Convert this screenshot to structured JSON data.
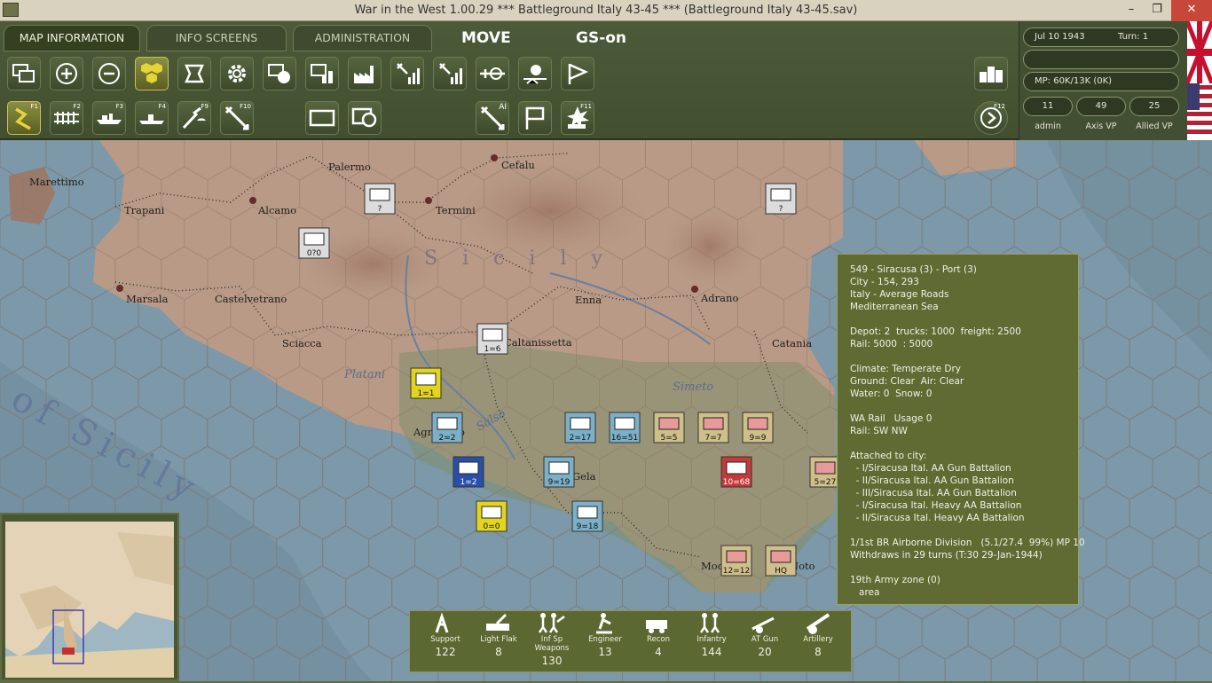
{
  "window": {
    "title": "War in the West 1.00.29          ***   Battleground Italy 43-45   ***   (Battleground Italy 43-45.sav)",
    "minimize": "–",
    "maximize": "❐",
    "close": "✕"
  },
  "tabs": [
    {
      "label": "MAP INFORMATION",
      "active": true
    },
    {
      "label": "INFO SCREENS",
      "active": false
    },
    {
      "label": "ADMINISTRATION",
      "active": false
    }
  ],
  "mode": {
    "phase": "MOVE",
    "gs": "GS-on"
  },
  "toolbar_row1": [
    "windows-icon",
    "zoom-in-icon",
    "zoom-out-icon",
    "hex-grid-icon",
    "frame-icon",
    "gear-icon",
    "unit-display-icon",
    "depot-icon",
    "factory-icon",
    "air-interdict-icon",
    "air-supply-icon",
    "airfield-icon",
    "weather-icon",
    "flag-icon"
  ],
  "toolbar_row2": [
    {
      "icon": "move-path-icon",
      "key": "F1"
    },
    {
      "icon": "rail-icon",
      "key": "F2"
    },
    {
      "icon": "naval-transport-icon",
      "key": "F3"
    },
    {
      "icon": "amphibious-icon",
      "key": "F4"
    },
    {
      "icon": "airdrop-icon",
      "key": "F9"
    },
    {
      "icon": "air-attack-icon",
      "key": "F10"
    },
    {
      "icon": "rectangle-icon",
      "key": ""
    },
    {
      "icon": "zone-icon",
      "key": ""
    },
    {
      "icon": "ai-attack-icon",
      "key": "AI"
    },
    {
      "icon": "hq-flag-icon",
      "key": ""
    },
    {
      "icon": "explosion-icon",
      "key": "F11"
    },
    {
      "icon": "end-turn-icon",
      "key": "F12"
    }
  ],
  "status": {
    "date": "Jul 10 1943",
    "turn": "Turn: 1",
    "mp": "MP:  60K/13K (0K)",
    "admin_value": "11",
    "admin_label": "admin",
    "axis_vp": "49",
    "axis_label": "Axis VP",
    "allied_vp": "25",
    "allied_label": "Allied VP"
  },
  "map_labels": [
    {
      "text": "Marettimo"
    },
    {
      "text": "Trapani"
    },
    {
      "text": "Alcamo"
    },
    {
      "text": "Palermo"
    },
    {
      "text": "Termini"
    },
    {
      "text": "Cefalu"
    },
    {
      "text": "Marsala"
    },
    {
      "text": "Castelvetrano"
    },
    {
      "text": "Sciacca"
    },
    {
      "text": "Caltanissetta"
    },
    {
      "text": "Enna"
    },
    {
      "text": "Adrano"
    },
    {
      "text": "Catania"
    },
    {
      "text": "Agrigento"
    },
    {
      "text": "Gela"
    },
    {
      "text": "Modica"
    },
    {
      "text": "Noto"
    },
    {
      "text": "Sicily"
    },
    {
      "text": "Platani"
    },
    {
      "text": "Salso"
    },
    {
      "text": "Simeto"
    },
    {
      "text": "of Sicily"
    }
  ],
  "counters": [
    {
      "label": "?",
      "side": "axis-unknown"
    },
    {
      "label": "?",
      "side": "axis-unknown"
    },
    {
      "label": "0?0",
      "side": "axis-unknown"
    },
    {
      "label": "1=6",
      "side": "axis"
    },
    {
      "label": "1=1",
      "side": "allied"
    },
    {
      "label": "2=2",
      "side": "allied"
    },
    {
      "label": "1=2",
      "side": "allied"
    },
    {
      "label": "9=19",
      "side": "allied"
    },
    {
      "label": "2=17",
      "side": "allied"
    },
    {
      "label": "16=51",
      "side": "allied"
    },
    {
      "label": "5=5",
      "side": "axis"
    },
    {
      "label": "7=7",
      "side": "axis"
    },
    {
      "label": "9=9",
      "side": "axis"
    },
    {
      "label": "10=68",
      "side": "axis"
    },
    {
      "label": "5=27",
      "side": "axis"
    },
    {
      "label": "0=0",
      "side": "allied"
    },
    {
      "label": "9=18",
      "side": "allied"
    },
    {
      "label": "12=12",
      "side": "axis"
    },
    {
      "label": "HQ",
      "side": "axis"
    }
  ],
  "info_panel": {
    "lines": [
      "549 - Siracusa (3) - Port (3)",
      "City - 154, 293",
      "Italy - Average Roads",
      "Mediterranean Sea",
      "",
      "Depot: 2  trucks: 1000  freight: 2500",
      "Rail: 5000  : 5000",
      "",
      "Climate: Temperate Dry",
      "Ground: Clear  Air: Clear",
      "Water: 0  Snow: 0",
      "",
      "WA Rail   Usage 0",
      "Rail: SW NW",
      "",
      "Attached to city:",
      "  - I/Siracusa Ital. AA Gun Battalion",
      "  - II/Siracusa Ital. AA Gun Battalion",
      "  - III/Siracusa Ital. AA Gun Battalion",
      "  - I/Siracusa Ital. Heavy AA Battalion",
      "  - II/Siracusa Ital. Heavy AA Battalion",
      "",
      "1/1st BR Airborne Division   (5.1/27.4  99%) MP 10",
      "Withdraws in 29 turns (T:30 29-Jan-1944)",
      "",
      "19th Army zone (0)",
      "   area"
    ]
  },
  "unit_summary": [
    {
      "name": "Support",
      "count": "122",
      "icon": "support-icon"
    },
    {
      "name": "Light Flak",
      "count": "8",
      "icon": "light-flak-icon"
    },
    {
      "name": "Inf Sp Weapons",
      "count": "130",
      "icon": "inf-sp-weapons-icon"
    },
    {
      "name": "Engineer",
      "count": "13",
      "icon": "engineer-icon"
    },
    {
      "name": "Recon",
      "count": "4",
      "icon": "recon-icon"
    },
    {
      "name": "Infantry",
      "count": "144",
      "icon": "infantry-icon"
    },
    {
      "name": "AT Gun",
      "count": "20",
      "icon": "at-gun-icon"
    },
    {
      "name": "Artillery",
      "count": "8",
      "icon": "artillery-icon"
    }
  ],
  "colors": {
    "panel": "#5f6b33",
    "toolbar": "#4c5a39",
    "sea": "#7d98a8",
    "land": "#b89a86",
    "allied_counter": "#e1d31c",
    "axis_counter": "#d9c690",
    "german": "#4a9ec4"
  }
}
